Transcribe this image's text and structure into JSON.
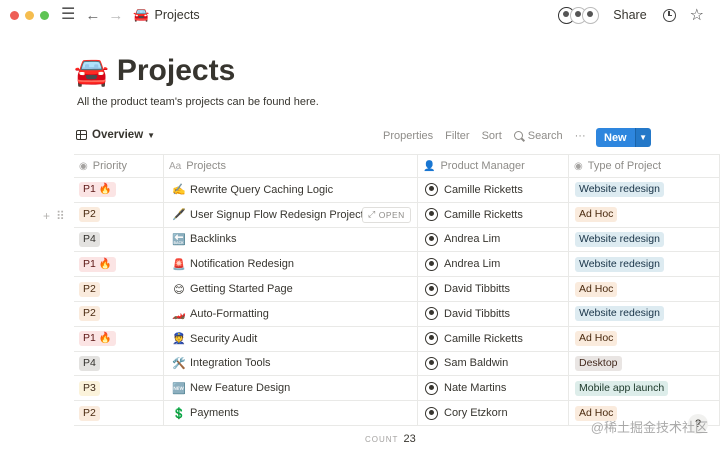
{
  "topbar": {
    "breadcrumb_emoji": "🚘",
    "breadcrumb_title": "Projects",
    "share_label": "Share"
  },
  "page": {
    "emoji": "🚘",
    "title": "Projects",
    "description": "All the product team's projects can be found here."
  },
  "view": {
    "name": "Overview",
    "actions": [
      "Properties",
      "Filter",
      "Sort"
    ],
    "search_label": "Search",
    "more": "···",
    "new_label": "New"
  },
  "columns": {
    "priority": "Priority",
    "projects": "Projects",
    "manager": "Product Manager",
    "type": "Type of Project"
  },
  "rows": [
    {
      "priority": "P1 🔥",
      "prio_class": "p1",
      "icon": "✍️",
      "name": "Rewrite Query Caching Logic",
      "manager": "Camille Ricketts",
      "type": "Website redesign",
      "type_class": "t-blue"
    },
    {
      "priority": "P2",
      "prio_class": "p2",
      "icon": "🖋️",
      "name": "User Signup Flow Redesign Project",
      "manager": "Camille Ricketts",
      "type": "Ad Hoc",
      "type_class": "t-orange"
    },
    {
      "priority": "P4",
      "prio_class": "p4",
      "icon": "🔙",
      "name": "Backlinks",
      "manager": "Andrea Lim",
      "type": "Website redesign",
      "type_class": "t-blue"
    },
    {
      "priority": "P1 🔥",
      "prio_class": "p1",
      "icon": "🚨",
      "name": "Notification Redesign",
      "manager": "Andrea Lim",
      "type": "Website redesign",
      "type_class": "t-blue"
    },
    {
      "priority": "P2",
      "prio_class": "p2",
      "icon": "😊",
      "name": "Getting Started Page",
      "manager": "David Tibbitts",
      "type": "Ad Hoc",
      "type_class": "t-orange"
    },
    {
      "priority": "P2",
      "prio_class": "p2",
      "icon": "🏎️",
      "name": "Auto-Formatting",
      "manager": "David Tibbitts",
      "type": "Website redesign",
      "type_class": "t-blue"
    },
    {
      "priority": "P1 🔥",
      "prio_class": "p1",
      "icon": "👮",
      "name": "Security Audit",
      "manager": "Camille Ricketts",
      "type": "Ad Hoc",
      "type_class": "t-orange"
    },
    {
      "priority": "P4",
      "prio_class": "p4",
      "icon": "🛠️",
      "name": "Integration Tools",
      "manager": "Sam Baldwin",
      "type": "Desktop",
      "type_class": "t-brown"
    },
    {
      "priority": "P3",
      "prio_class": "p3",
      "icon": "🆕",
      "name": "New Feature Design",
      "manager": "Nate Martins",
      "type": "Mobile app launch",
      "type_class": "t-green"
    },
    {
      "priority": "P2",
      "prio_class": "p2",
      "icon": "💲",
      "name": "Payments",
      "manager": "Cory Etzkorn",
      "type": "Ad Hoc",
      "type_class": "t-orange"
    }
  ],
  "open_label": "OPEN",
  "count_label": "COUNT",
  "count_value": "23",
  "watermark": "@稀土掘金技术社区",
  "help_label": "?"
}
